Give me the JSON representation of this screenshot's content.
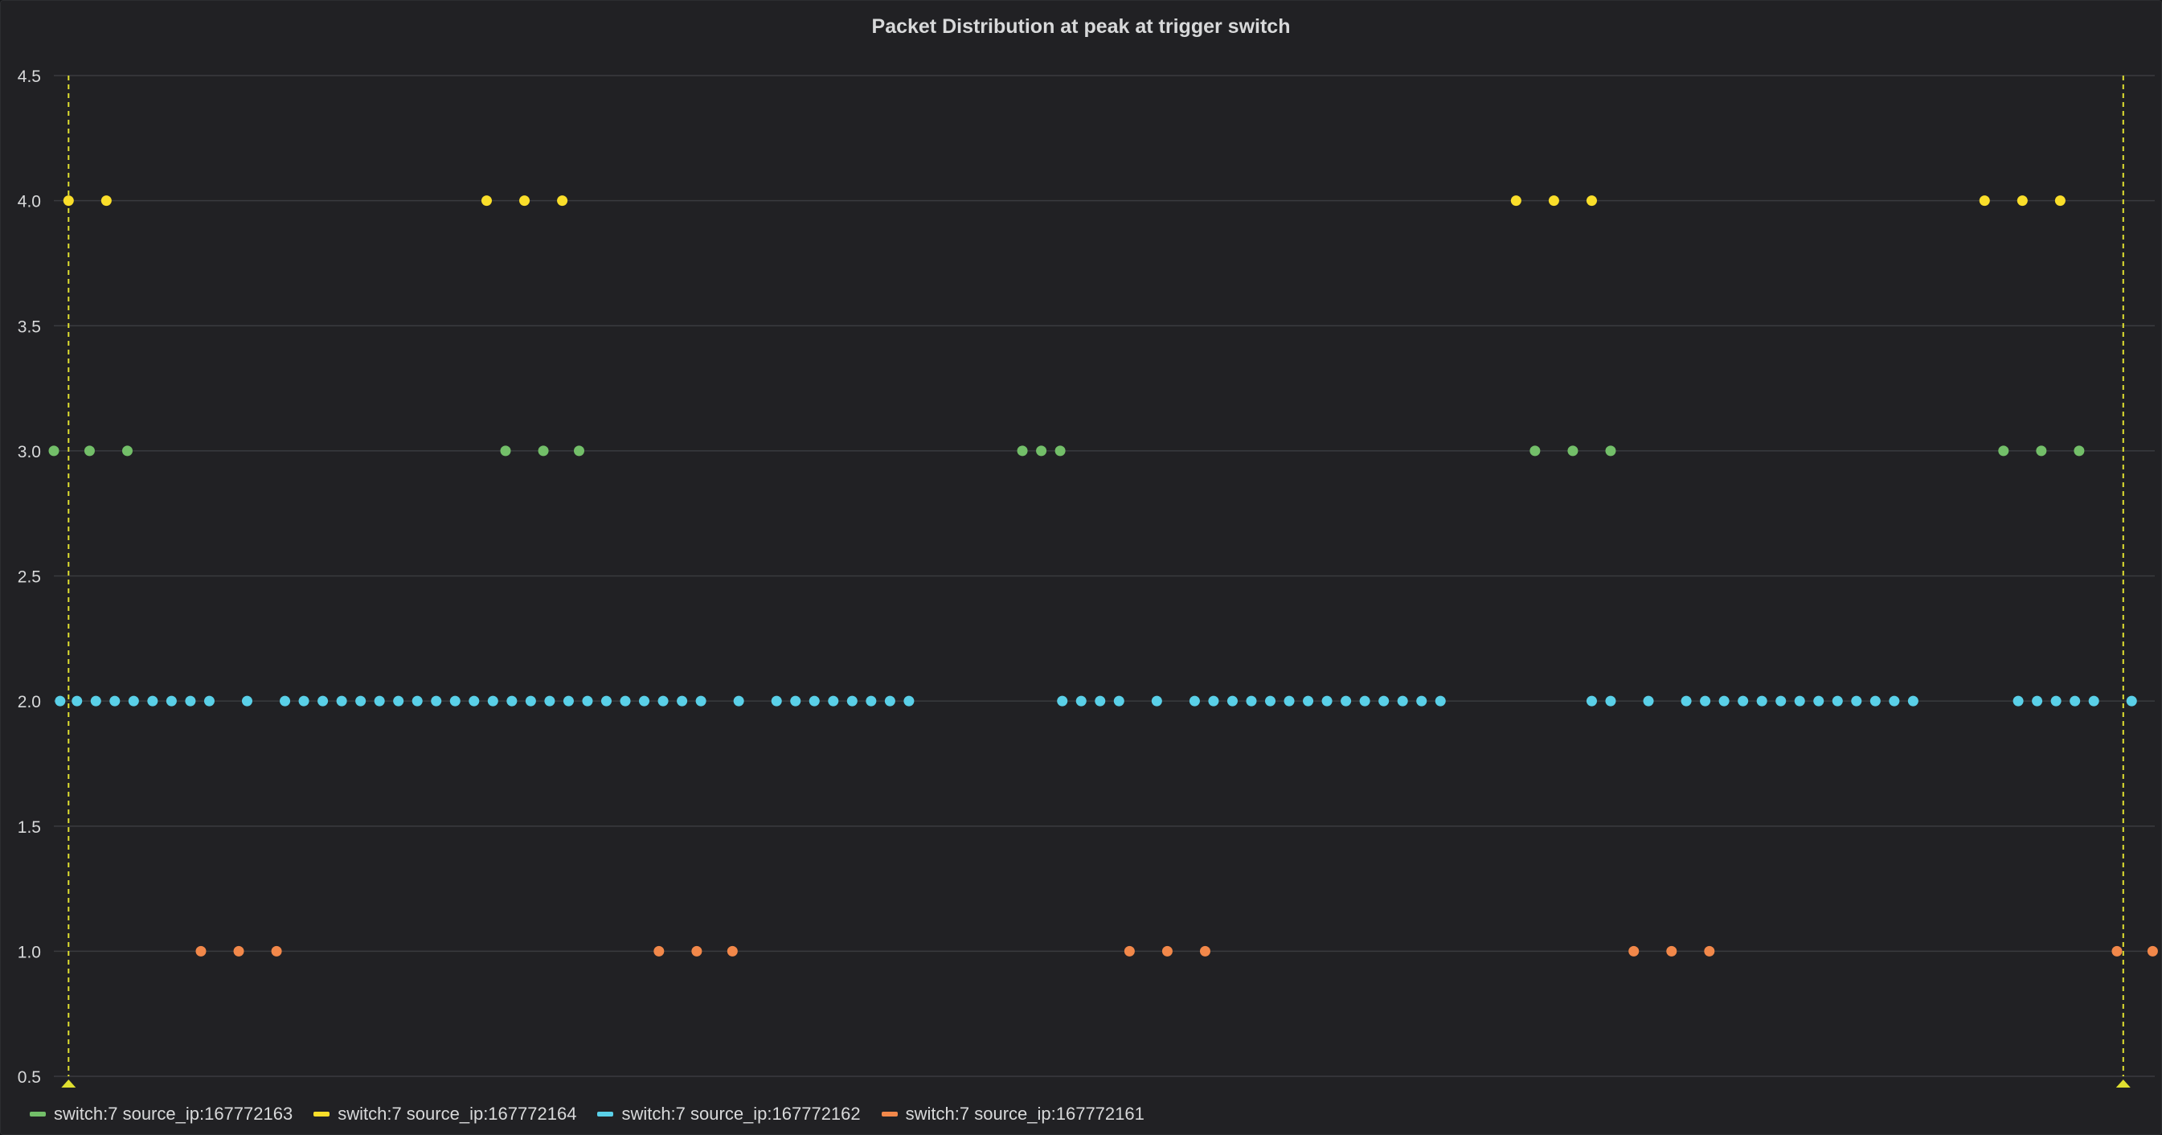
{
  "panel": {
    "title": "Packet Distribution at peak at trigger switch"
  },
  "legend_position": "bottom-left",
  "chart_data": {
    "type": "scatter",
    "title": "Packet Distribution at peak at trigger switch",
    "xlabel": "",
    "ylabel": "",
    "ylim": [
      0.5,
      4.5
    ],
    "xlim": [
      0,
      1000
    ],
    "yticks": [
      "0.5",
      "1.0",
      "1.5",
      "2.0",
      "2.5",
      "3.0",
      "3.5",
      "4.0",
      "4.5"
    ],
    "grid": true,
    "annotations": [
      {
        "type": "vertical-marker",
        "x": 7,
        "color": "#e0e030"
      },
      {
        "type": "vertical-marker",
        "x": 985,
        "color": "#e0e030"
      }
    ],
    "series": [
      {
        "name": "switch:7 source_ip:167772163",
        "color": "#73bf69",
        "y": 3,
        "x": [
          0,
          17,
          35,
          215,
          233,
          250,
          461,
          470,
          479,
          705,
          723,
          741,
          928,
          946,
          964
        ]
      },
      {
        "name": "switch:7 source_ip:167772164",
        "color": "#fade2a",
        "y": 4,
        "x": [
          7,
          25,
          206,
          224,
          242,
          696,
          714,
          732,
          919,
          937,
          955
        ]
      },
      {
        "name": "switch:7 source_ip:167772162",
        "color": "#5ad0e8",
        "y": 2,
        "x": [
          3,
          11,
          20,
          29,
          38,
          47,
          56,
          65,
          74,
          92,
          110,
          119,
          128,
          137,
          146,
          155,
          164,
          173,
          182,
          191,
          200,
          209,
          218,
          227,
          236,
          245,
          254,
          263,
          272,
          281,
          290,
          299,
          308,
          326,
          344,
          353,
          362,
          371,
          380,
          389,
          398,
          407,
          480,
          489,
          498,
          507,
          525,
          543,
          552,
          561,
          570,
          579,
          588,
          597,
          606,
          615,
          624,
          633,
          642,
          651,
          660,
          732,
          741,
          759,
          777,
          786,
          795,
          804,
          813,
          822,
          831,
          840,
          849,
          858,
          867,
          876,
          885,
          935,
          944,
          953,
          962,
          971,
          989
        ]
      },
      {
        "name": "switch:7 source_ip:167772161",
        "color": "#f2884a",
        "y": 1,
        "x": [
          70,
          88,
          106,
          288,
          306,
          323,
          512,
          530,
          548,
          752,
          770,
          788,
          982,
          999
        ]
      }
    ]
  }
}
